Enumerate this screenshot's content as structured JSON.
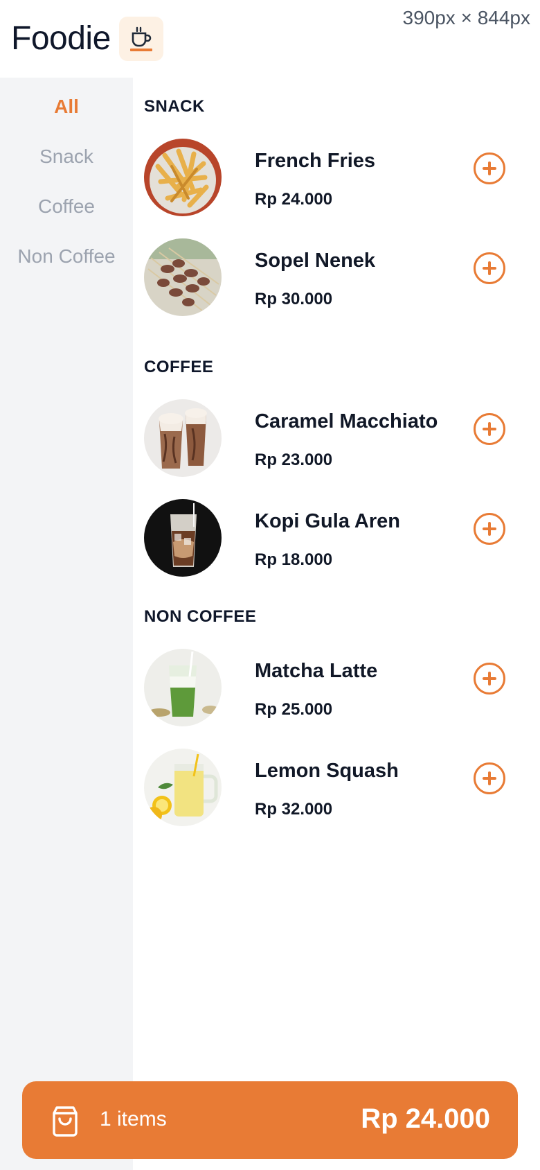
{
  "header": {
    "app_title": "Foodie",
    "viewport_label": "390px × 844px",
    "logo_icon": "coffee-cup-icon"
  },
  "sidebar": {
    "categories": [
      {
        "label": "All",
        "active": true
      },
      {
        "label": "Snack",
        "active": false
      },
      {
        "label": "Coffee",
        "active": false
      },
      {
        "label": "Non Coffee",
        "active": false
      }
    ]
  },
  "menu": {
    "sections": [
      {
        "title": "SNACK",
        "items": [
          {
            "name": "French Fries",
            "price": "Rp 24.000"
          },
          {
            "name": "Sopel Nenek",
            "price": "Rp 30.000"
          }
        ]
      },
      {
        "title": "COFFEE",
        "items": [
          {
            "name": "Caramel Macchiato",
            "price": "Rp 23.000"
          },
          {
            "name": "Kopi Gula Aren",
            "price": "Rp 18.000"
          }
        ]
      },
      {
        "title": "NON COFFEE",
        "items": [
          {
            "name": "Matcha Latte",
            "price": "Rp 25.000"
          },
          {
            "name": "Lemon Squash",
            "price": "Rp 32.000"
          }
        ]
      }
    ]
  },
  "cart": {
    "count_label": "1 items",
    "total": "Rp 24.000",
    "icon": "shopping-bag-icon"
  },
  "colors": {
    "accent": "#e87b35",
    "sidebar_bg": "#f3f4f6",
    "text_dark": "#0f172a",
    "text_muted": "#9ca3af"
  }
}
